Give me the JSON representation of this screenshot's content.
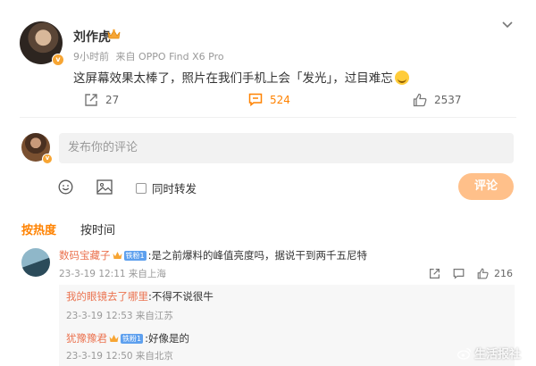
{
  "post": {
    "author": "刘作虎",
    "time": "9小时前",
    "source": "来自 OPPO Find X6 Pro",
    "text": "这屏幕效果太棒了，照片在我们手机上会「发光」，过目难忘",
    "repost_count": "27",
    "comment_count": "524",
    "like_count": "2537",
    "colors": {
      "accent": "#ff8200",
      "name": "#333333",
      "meta": "#999999"
    }
  },
  "composer": {
    "placeholder": "发布你的评论",
    "repost_label": "同时转发",
    "submit_label": "评论"
  },
  "sort": {
    "hot": "按热度",
    "time": "按时间"
  },
  "comments": [
    {
      "user": "数码宝藏子",
      "fan_badge": "铁粉1",
      "text": ":是之前爆料的峰值亮度吗，据说干到两千五尼特",
      "time": "23-3-19 12:11 来自上海",
      "like_count": "216"
    }
  ],
  "replies": [
    {
      "user": "我的眼镜去了哪里",
      "text": ":不得不说很牛",
      "time": "23-3-19 12:53 来自江苏"
    },
    {
      "user": "犹豫豫君",
      "fan_badge": "铁粉1",
      "text": ":好像是的",
      "time": "23-3-19 12:50 来自北京"
    }
  ],
  "watermark": "生活报社"
}
